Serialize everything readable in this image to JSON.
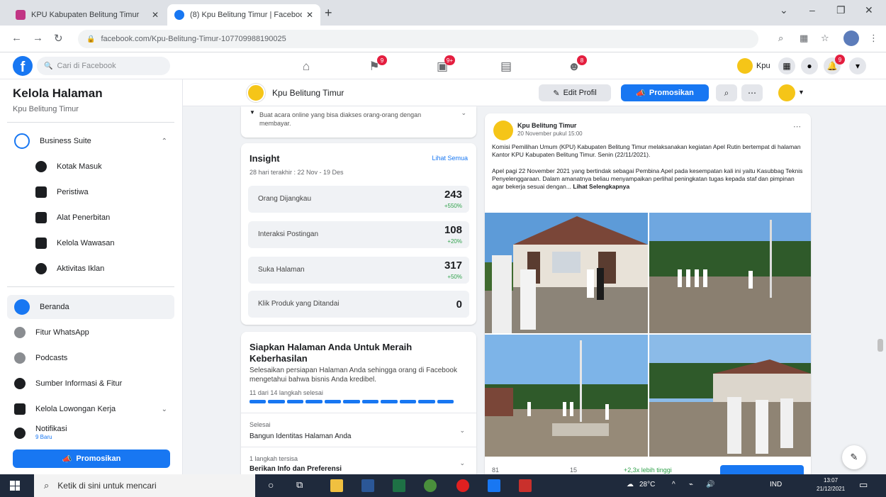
{
  "browser": {
    "tabs": [
      {
        "title": "KPU Kabupaten Belitung Timur"
      },
      {
        "title": "(8) Kpu Belitung Timur | Faceboo"
      }
    ],
    "url": "facebook.com/Kpu-Belitung-Timur-107709988190025"
  },
  "fb": {
    "search_placeholder": "Cari di Facebook",
    "badges": {
      "pages": "9",
      "watch": "9+",
      "groups": "8",
      "notifications": "9"
    },
    "me_label": "Kpu"
  },
  "sidebar": {
    "title": "Kelola Halaman",
    "page_name": "Kpu Belitung Timur",
    "business_suite": "Business Suite",
    "sub_items": [
      "Kotak Masuk",
      "Peristiwa",
      "Alat Penerbitan",
      "Kelola Wawasan",
      "Aktivitas Iklan"
    ],
    "nav_items": [
      "Beranda",
      "Fitur WhatsApp",
      "Podcasts",
      "Sumber Informasi & Fitur",
      "Kelola Lowongan Kerja",
      "Notifikasi"
    ],
    "notif_sub": "9 Baru",
    "promote": "Promosikan"
  },
  "header": {
    "page_name": "Kpu Belitung Timur",
    "edit": "Edit Profil",
    "promote": "Promosikan"
  },
  "top_card": {
    "text": "Buat acara online yang bisa diakses orang-orang dengan membayar."
  },
  "insight": {
    "title": "Insight",
    "link": "Lihat Semua",
    "range": "28 hari terakhir : 22 Nov - 19 Des",
    "metrics": [
      {
        "label": "Orang Dijangkau",
        "value": "243",
        "change": "+550%"
      },
      {
        "label": "Interaksi Postingan",
        "value": "108",
        "change": "+20%"
      },
      {
        "label": "Suka Halaman",
        "value": "317",
        "change": "+50%"
      },
      {
        "label": "Klik Produk yang Ditandai",
        "value": "0",
        "change": ""
      }
    ]
  },
  "setup": {
    "title": "Siapkan Halaman Anda Untuk Meraih Keberhasilan",
    "desc": "Selesaikan persiapan Halaman Anda sehingga orang di Facebook mengetahui bahwa bisnis Anda kredibel.",
    "progress": "11 dari 14 langkah selesai",
    "progress_value": 0.79,
    "step1_label": "Selesai",
    "step1_name": "Bangun Identitas Halaman Anda",
    "step2_label": "1 langkah tersisa",
    "step2_name": "Berikan Info dan Preferensi"
  },
  "post": {
    "author": "Kpu Belitung Timur",
    "time": "20 November pukul 15:00",
    "para1": "Komisi Pemilihan Umum (KPU) Kabupaten Belitung Timur melaksanakan kegiatan Apel Rutin bertempat di halaman Kantor KPU Kabupaten Belitung Timur. Senin (22/11/2021).",
    "para2": "Apel pagi 22 November 2021 yang bertindak sebagai Pembina Apel pada kesempatan kali ini yaitu Kasubbag Teknis Penyelenggaraan. Dalam amanatnya beliau menyampaikan perlihal peningkatan tugas kepada staf dan pimpinan agar bekerja sesuai dengan...",
    "see_more": "Lihat Selengkapnya",
    "reach": "+2,3x lebih tinggi",
    "foot_a": "81",
    "foot_b": "15"
  },
  "taskbar": {
    "search": "Ketik di sini untuk mencari",
    "weather": "28°C",
    "lang": "IND",
    "time": "13:07",
    "date": "21/12/2021"
  }
}
